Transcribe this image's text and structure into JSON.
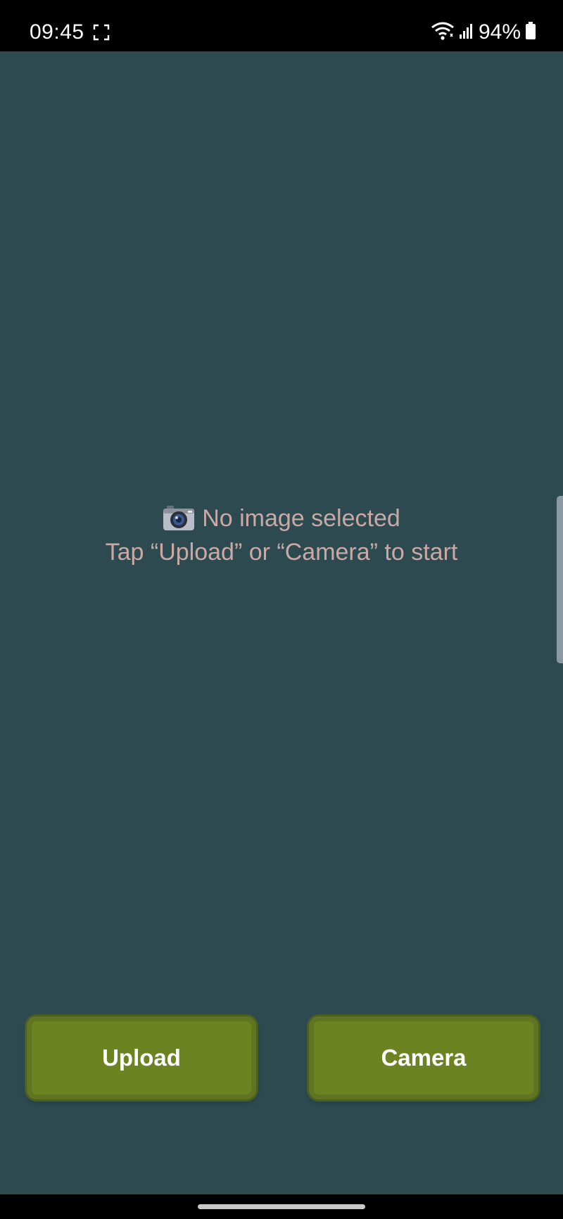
{
  "status_bar": {
    "time": "09:45",
    "battery": "94%",
    "icons": [
      "screen-capture-icon",
      "wifi-icon",
      "signal-icon",
      "battery-icon"
    ]
  },
  "placeholder": {
    "icon": "camera-icon",
    "title": "No image selected",
    "hint": "Tap “Upload” or “Camera” to start"
  },
  "buttons": {
    "upload_label": "Upload",
    "camera_label": "Camera"
  },
  "colors": {
    "background": "#2d4a51",
    "button": "#6b8320",
    "placeholder_text": "#c9a9a6",
    "status_bar": "#000000"
  }
}
